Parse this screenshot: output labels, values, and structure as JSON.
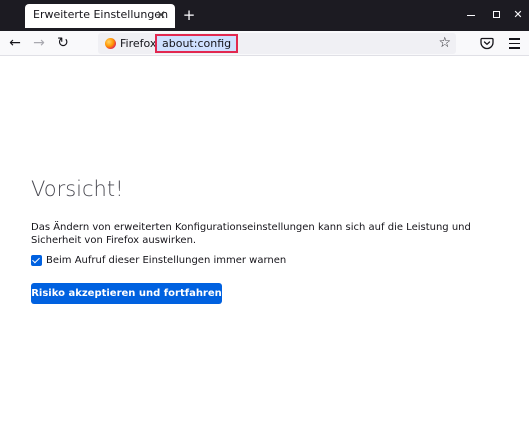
{
  "tab": {
    "title": "Erweiterte Einstellungen",
    "close_glyph": "✕"
  },
  "new_tab_glyph": "+",
  "window_controls": {
    "close_glyph": "✕"
  },
  "nav": {
    "back_glyph": "←",
    "forward_glyph": "→",
    "reload_glyph": "↻"
  },
  "urlbar": {
    "identity_label": "Firefox",
    "url": "about:config",
    "bookmark_glyph": "☆",
    "highlight_color": "#e22850"
  },
  "content": {
    "heading": "Vorsicht!",
    "warning_text": "Das Ändern von erweiterten Konfigurationseinstellungen kann sich auf die Leistung und Sicherheit von Firefox auswirken.",
    "checkbox_label": "Beim Aufruf dieser Einstellungen immer warnen",
    "checkbox_checked": true,
    "accept_button": "Risiko akzeptieren und fortfahren",
    "accent_color": "#0061e0"
  },
  "icons": [
    "firefox-logo-icon",
    "star-icon",
    "pocket-icon",
    "hamburger-menu-icon",
    "back-arrow-icon",
    "forward-arrow-icon",
    "reload-icon"
  ]
}
